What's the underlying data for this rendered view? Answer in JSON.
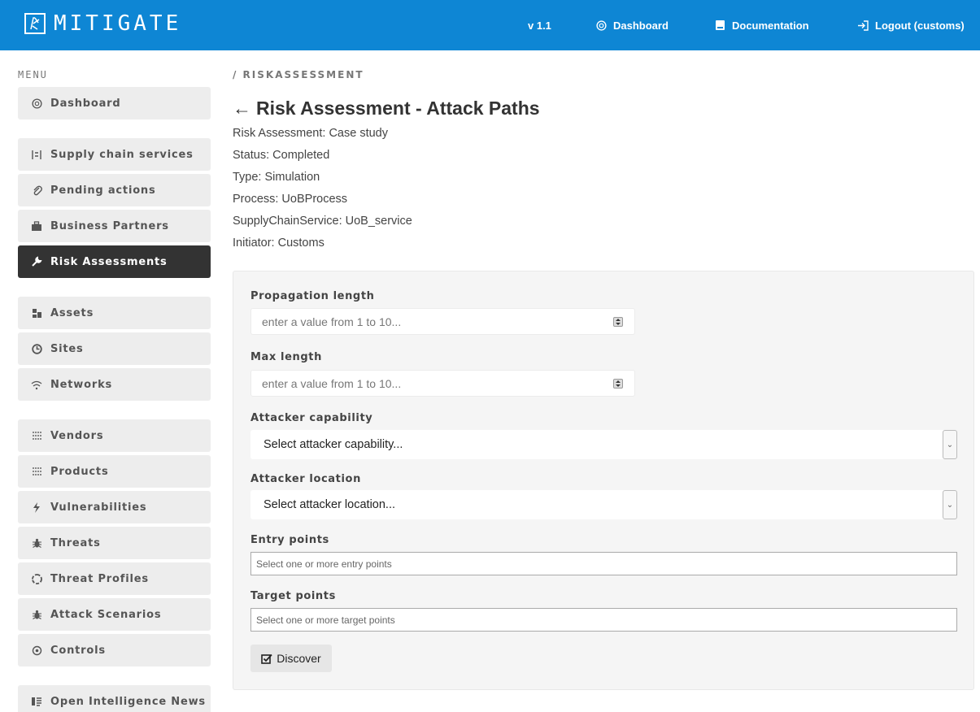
{
  "header": {
    "app_name": "MITIGATE",
    "version": "v 1.1",
    "nav": {
      "dashboard": "Dashboard",
      "documentation": "Documentation",
      "logout": "Logout (customs)"
    },
    "bg_color": "#0e86d4"
  },
  "sidebar": {
    "title": "MENU",
    "items": [
      {
        "label": "Dashboard",
        "icon": "dashboard-icon"
      },
      {
        "label": "Supply chain services",
        "icon": "supply-chain-icon"
      },
      {
        "label": "Pending actions",
        "icon": "paperclip-icon"
      },
      {
        "label": "Business Partners",
        "icon": "briefcase-icon"
      },
      {
        "label": "Risk Assessments",
        "icon": "wrench-icon",
        "active": true
      },
      {
        "label": "Assets",
        "icon": "assets-icon"
      },
      {
        "label": "Sites",
        "icon": "sites-icon"
      },
      {
        "label": "Networks",
        "icon": "wifi-icon"
      },
      {
        "label": "Vendors",
        "icon": "grid-icon"
      },
      {
        "label": "Products",
        "icon": "grid-icon"
      },
      {
        "label": "Vulnerabilities",
        "icon": "bolt-icon"
      },
      {
        "label": "Threats",
        "icon": "bug-icon"
      },
      {
        "label": "Threat Profiles",
        "icon": "recycle-icon"
      },
      {
        "label": "Attack Scenarios",
        "icon": "bug-icon"
      },
      {
        "label": "Controls",
        "icon": "eye-icon"
      },
      {
        "label": "Open Intelligence News",
        "icon": "news-icon"
      }
    ],
    "active_color": "#333333"
  },
  "main": {
    "breadcrumb": "/ RISKASSESSMENT",
    "back_arrow": "←",
    "title": "Risk Assessment - Attack Paths",
    "meta": [
      "Risk Assessment: Case study",
      "Status: Completed",
      "Type: Simulation",
      "Process: UoBProcess",
      "SupplyChainService: UoB_service",
      "Initiator: Customs"
    ],
    "form": {
      "propagation_length": {
        "label": "Propagation length",
        "placeholder": "enter a value from 1 to 10..."
      },
      "max_length": {
        "label": "Max length",
        "placeholder": "enter a value from 1 to 10..."
      },
      "attacker_capability": {
        "label": "Attacker capability",
        "value": "Select attacker capability..."
      },
      "attacker_location": {
        "label": "Attacker location",
        "value": "Select attacker location..."
      },
      "entry_points": {
        "label": "Entry points",
        "placeholder": "Select one or more entry points"
      },
      "target_points": {
        "label": "Target points",
        "placeholder": "Select one or more target points"
      },
      "discover_label": "Discover"
    }
  }
}
